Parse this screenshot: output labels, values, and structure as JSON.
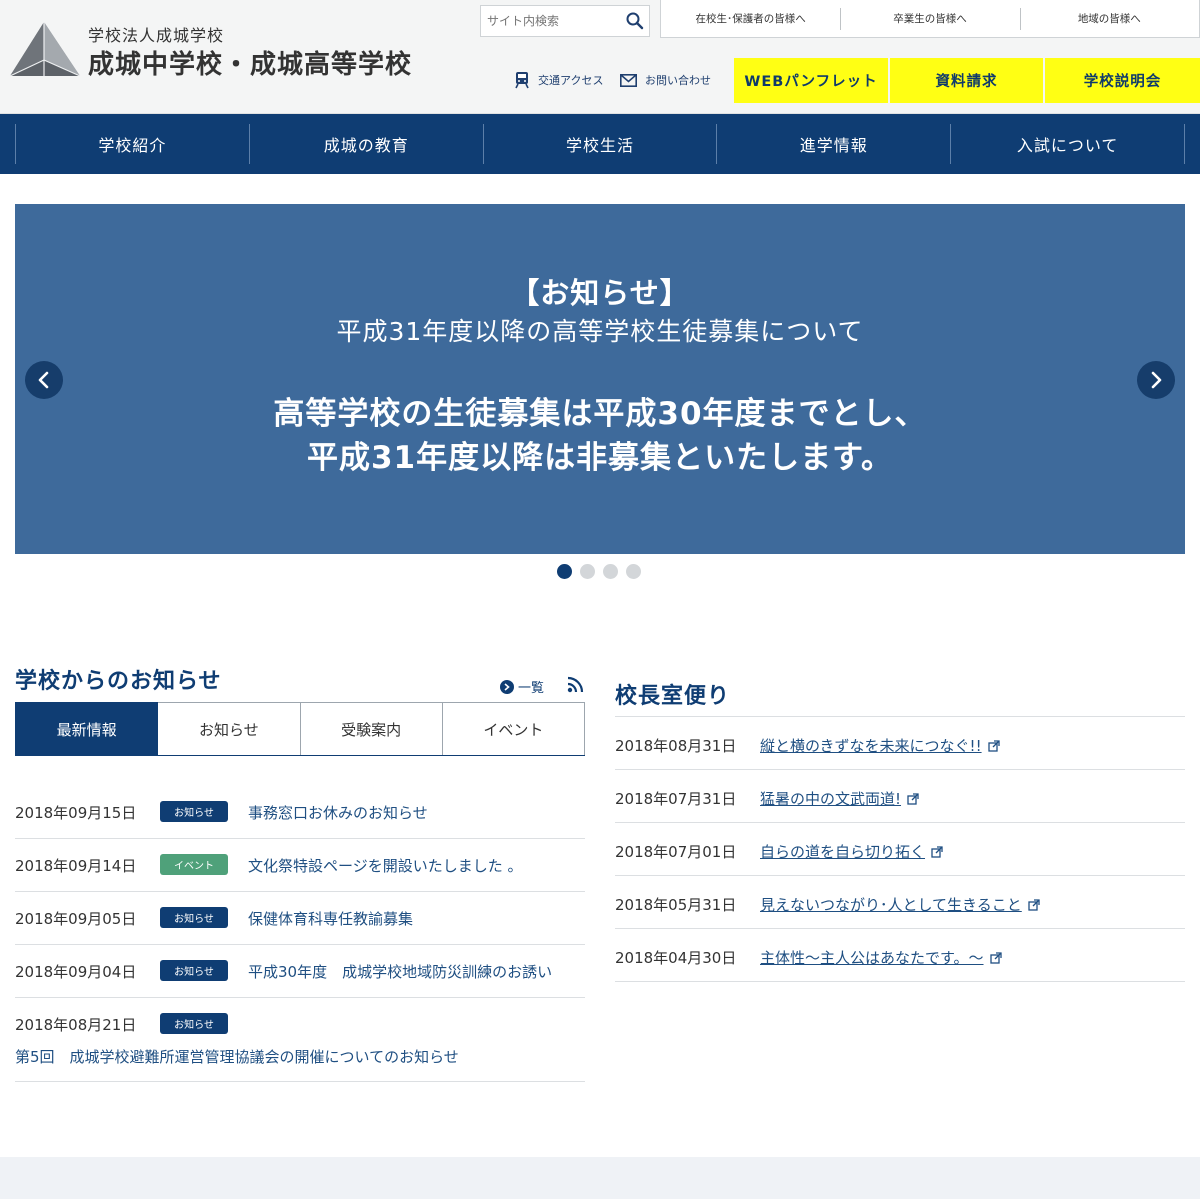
{
  "header": {
    "logo_sub": "学校法人成城学校",
    "logo_main": "成城中学校・成城高等学校",
    "search_placeholder": "サイト内検索",
    "audience_links": [
      "在校生･保護者の皆様へ",
      "卒業生の皆様へ",
      "地域の皆様へ"
    ],
    "access_label": "交通アクセス",
    "contact_label": "お問い合わせ",
    "cta": [
      "WEBパンフレット",
      "資料請求",
      "学校説明会"
    ]
  },
  "nav": [
    "学校紹介",
    "成城の教育",
    "学校生活",
    "進学情報",
    "入試について"
  ],
  "hero": {
    "line1": "【お知らせ】",
    "line2": "平成31年度以降の高等学校生徒募集について",
    "line3": "高等学校の生徒募集は平成30年度までとし、",
    "line4": "平成31年度以降は非募集といたします。",
    "slide_count": 4,
    "active_slide": 1
  },
  "news": {
    "title": "学校からのお知らせ",
    "list_link": "一覧",
    "tabs": [
      "最新情報",
      "お知らせ",
      "受験案内",
      "イベント"
    ],
    "active_tab": 0,
    "items": [
      {
        "date": "2018年09月15日",
        "badge": "お知らせ",
        "title": "事務窓口お休みのお知らせ"
      },
      {
        "date": "2018年09月14日",
        "badge": "イベント",
        "title": "文化祭特設ページを開設いたしました 。"
      },
      {
        "date": "2018年09月05日",
        "badge": "お知らせ",
        "title": "保健体育科専任教諭募集"
      },
      {
        "date": "2018年09月04日",
        "badge": "お知らせ",
        "title": "平成30年度　成城学校地域防災訓練のお誘い"
      },
      {
        "date": "2018年08月21日",
        "badge": "お知らせ",
        "title": "第5回　成城学校避難所運営管理協議会の開催についてのお知らせ"
      }
    ]
  },
  "principal": {
    "title": "校長室便り",
    "items": [
      {
        "date": "2018年08月31日",
        "title": "縦と横のきずなを未来につなぐ!!"
      },
      {
        "date": "2018年07月31日",
        "title": "猛暑の中の文武両道!"
      },
      {
        "date": "2018年07月01日",
        "title": "自らの道を自ら切り拓く"
      },
      {
        "date": "2018年05月31日",
        "title": "見えないつながり･人として生きること"
      },
      {
        "date": "2018年04月30日",
        "title": "主体性～主人公はあなたです。～"
      }
    ]
  },
  "colors": {
    "navy": "#0f3d73",
    "hero_bg": "#3e6a9b",
    "cta_yellow": "#ffff14",
    "event_green": "#4fa17a"
  },
  "icons": [
    "search-icon",
    "train-icon",
    "mail-icon",
    "chevron-left-icon",
    "chevron-right-icon",
    "arrow-circle-icon",
    "rss-icon",
    "external-link-icon"
  ]
}
